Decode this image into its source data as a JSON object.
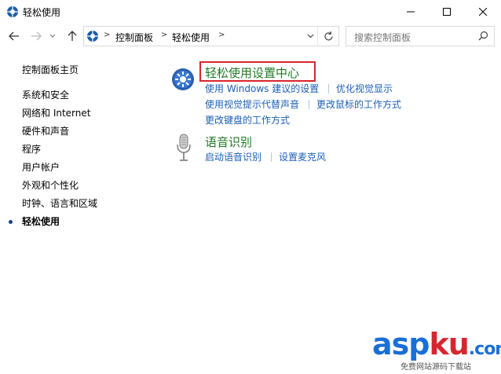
{
  "window": {
    "title": "轻松使用"
  },
  "address": {
    "crumbs": [
      "控制面板",
      "轻松使用"
    ],
    "search_placeholder": "搜索控制面板"
  },
  "sidebar": {
    "items": [
      {
        "label": "控制面板主页"
      },
      {
        "label": "系统和安全"
      },
      {
        "label": "网络和 Internet"
      },
      {
        "label": "硬件和声音"
      },
      {
        "label": "程序"
      },
      {
        "label": "用户帐户"
      },
      {
        "label": "外观和个性化"
      },
      {
        "label": "时钟、语言和区域"
      },
      {
        "label": "轻松使用",
        "active": true
      }
    ]
  },
  "main": {
    "ease_center": {
      "title": "轻松使用设置中心",
      "links": [
        "使用 Windows 建议的设置",
        "优化视觉显示",
        "使用视觉提示代替声音",
        "更改鼠标的工作方式",
        "更改键盘的工作方式"
      ]
    },
    "speech": {
      "title": "语音识别",
      "links": [
        "启动语音识别",
        "设置麦克风"
      ]
    }
  },
  "watermark": {
    "part1": "asp",
    "part2": "ku",
    "part3": ".com",
    "subtitle": "免费网站源码下载站"
  },
  "colors": {
    "link": "#1b5fb5",
    "category_title": "#1f7a24",
    "highlight_border": "#d8262e"
  }
}
